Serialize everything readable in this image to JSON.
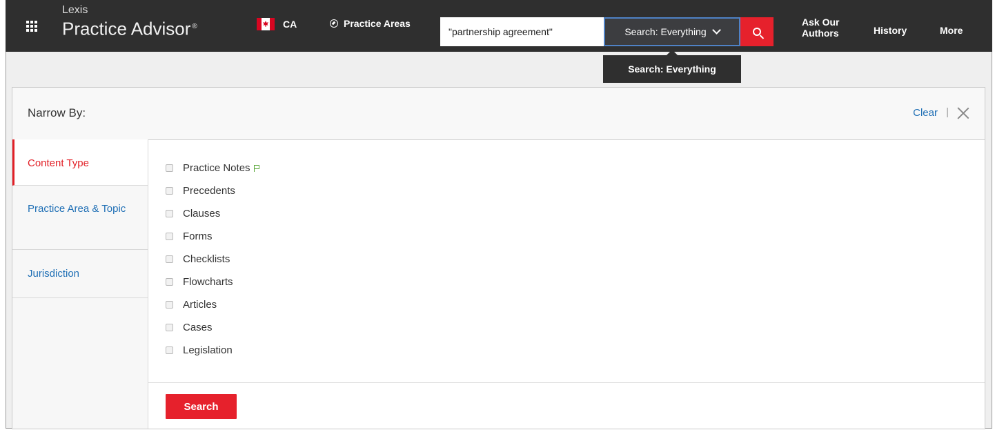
{
  "header": {
    "brand_small": "Lexis",
    "brand_big": "Practice Advisor",
    "brand_mark": "®",
    "country": "CA",
    "practice_areas": "Practice Areas",
    "search_value": "\"partnership agreement\"",
    "scope_label": "Search: Everything",
    "ask_line1": "Ask Our",
    "ask_line2": "Authors",
    "history": "History",
    "more": "More"
  },
  "tooltip": {
    "text": "Search: Everything"
  },
  "panel": {
    "title": "Narrow By:",
    "clear": "Clear",
    "separator": "|",
    "tabs": [
      {
        "label": "Content Type"
      },
      {
        "label": "Practice Area & Topic"
      },
      {
        "label": "Jurisdiction"
      }
    ],
    "options": [
      "Practice Notes",
      "Precedents",
      "Clauses",
      "Forms",
      "Checklists",
      "Flowcharts",
      "Articles",
      "Cases",
      "Legislation"
    ],
    "search_button": "Search"
  },
  "colors": {
    "topbar": "#2f2f2f",
    "accent_red": "#e6212c",
    "link_blue": "#1f6fb5",
    "scope_border": "#4f82c6"
  }
}
